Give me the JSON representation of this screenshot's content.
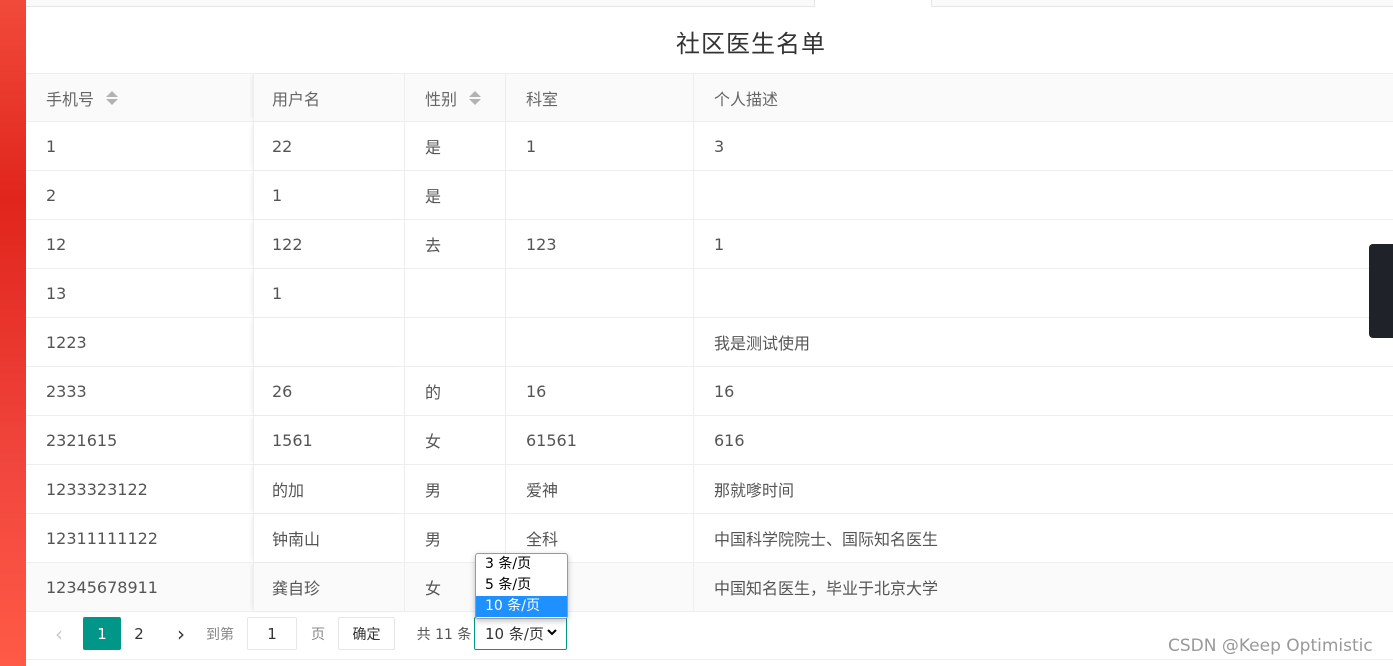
{
  "page": {
    "title": "社区医生名单"
  },
  "table": {
    "columns": [
      {
        "label": "手机号",
        "sortable": true
      },
      {
        "label": "用户名",
        "sortable": false
      },
      {
        "label": "性别",
        "sortable": true
      },
      {
        "label": "科室",
        "sortable": false
      },
      {
        "label": "个人描述",
        "sortable": false
      }
    ],
    "rows": [
      [
        "1",
        "22",
        "是",
        "1",
        "3"
      ],
      [
        "2",
        "1",
        "是",
        "",
        ""
      ],
      [
        "12",
        "122",
        "去",
        "123",
        "1"
      ],
      [
        "13",
        "1",
        "",
        "",
        ""
      ],
      [
        "1223",
        "",
        "",
        "",
        "我是测试使用"
      ],
      [
        "2333",
        "26",
        "的",
        "16",
        "16"
      ],
      [
        "2321615",
        "1561",
        "女",
        "61561",
        "616"
      ],
      [
        "1233323122",
        "的加",
        "男",
        "爱神",
        "那就嗲时间"
      ],
      [
        "12311111122",
        "钟南山",
        "男",
        "全科",
        "中国科学院院士、国际知名医生"
      ],
      [
        "12345678911",
        "龚自珍",
        "女",
        "",
        "中国知名医生，毕业于北京大学"
      ]
    ]
  },
  "pagination": {
    "prev_icon": "‹",
    "pages": [
      "1",
      "2"
    ],
    "current_page": "1",
    "next_icon": "›",
    "goto_label": "到第",
    "goto_value": "1",
    "page_unit": "页",
    "confirm_label": "确定",
    "total_label": "共 11 条",
    "page_size_selected": "10 条/页",
    "page_size_options": [
      "3 条/页",
      "5 条/页",
      "10 条/页"
    ]
  },
  "watermark": "CSDN @Keep Optimistic",
  "colors": {
    "accent": "#009688",
    "option_highlight": "#1e90ff",
    "left_stripe": "#e0251c"
  }
}
